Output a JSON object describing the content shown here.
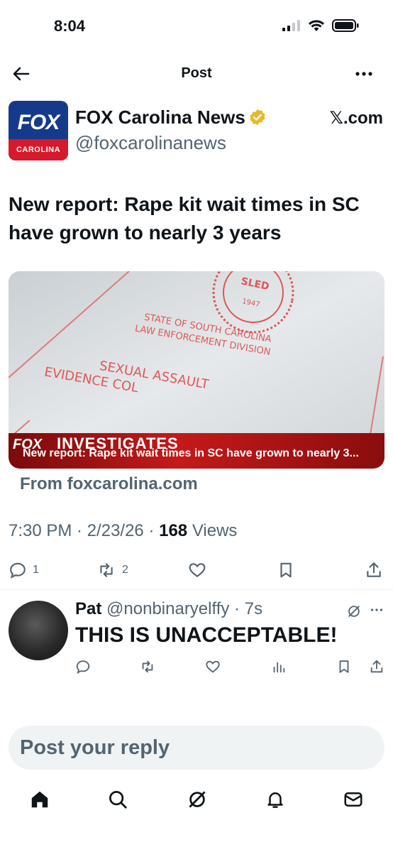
{
  "status_bar": {
    "time": "8:04",
    "icons": [
      "signal-icon",
      "wifi-icon",
      "battery-icon"
    ]
  },
  "header": {
    "title": "Post",
    "back_icon": "arrow-left-icon",
    "more_icon": "more-horizontal-icon"
  },
  "post": {
    "author": {
      "name": "FOX Carolina News",
      "handle": "@foxcarolinanews",
      "verified": true,
      "verified_color": "#e8b829",
      "logo_text": "FOX",
      "logo_subtext": "CAROLINA"
    },
    "source_site": "𝕏.com",
    "headline": "New report: Rape kit wait times in SC have grown to nearly 3 years",
    "card": {
      "caption": "New report: Rape kit wait times in SC have grown to nearly 3...",
      "overlay_brand": "FOX",
      "overlay_label": "INVESTIGATES",
      "image_text": [
        "SLED",
        "STATE OF SOUTH CAROLINA",
        "LAW ENFORCEMENT DIVISION",
        "SEXUAL ASSAULT",
        "EVIDENCE COL"
      ]
    },
    "source_link": "From foxcarolina.com",
    "timestamp": "7:30 PM · 2/23/26 · ",
    "views_count": "168",
    "views_label": " Views",
    "actions": {
      "replies": "1",
      "reposts": "2",
      "likes": "",
      "icons": [
        "reply-icon",
        "repost-icon",
        "like-icon",
        "bookmark-icon",
        "share-icon"
      ]
    }
  },
  "reply": {
    "name": "Pat",
    "handle": "@nonbinaryelffy",
    "time": "7s",
    "text": "THIS IS UNACCEPTABLE!",
    "icons": [
      "reply-icon",
      "repost-icon",
      "like-icon",
      "views-icon",
      "bookmark-icon",
      "share-icon"
    ]
  },
  "compose": {
    "placeholder": "Post your reply"
  },
  "tabbar": {
    "items": [
      "home-icon",
      "search-icon",
      "grok-icon",
      "notifications-icon",
      "messages-icon"
    ]
  },
  "colors": {
    "text": "#0f1419",
    "secondary": "#536471",
    "fox_blue": "#163a8a",
    "fox_red": "#d7192c",
    "divider": "#eff3f4"
  }
}
